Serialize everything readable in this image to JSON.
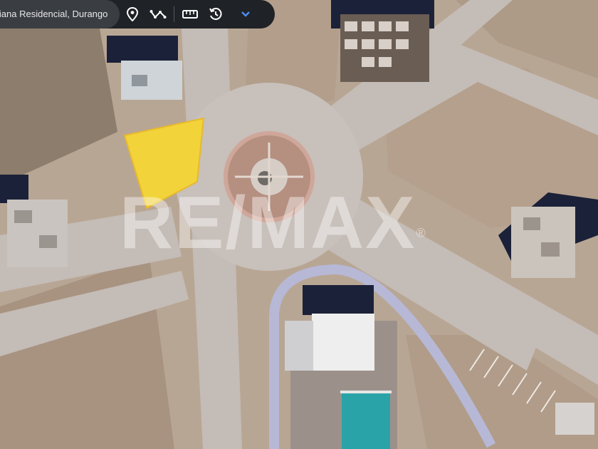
{
  "toolbar": {
    "address": "liana Residencial, Durango",
    "icons": [
      "location-pin-icon",
      "route-icon",
      "ruler-icon",
      "history-icon",
      "chevron-down-icon"
    ],
    "icon_color": "#ffffff",
    "accent_color": "#4e8df5"
  },
  "map": {
    "type": "satellite",
    "highlight_color": "#f2d33a",
    "watermark": "RE/MAX",
    "watermark_mark": "®"
  }
}
